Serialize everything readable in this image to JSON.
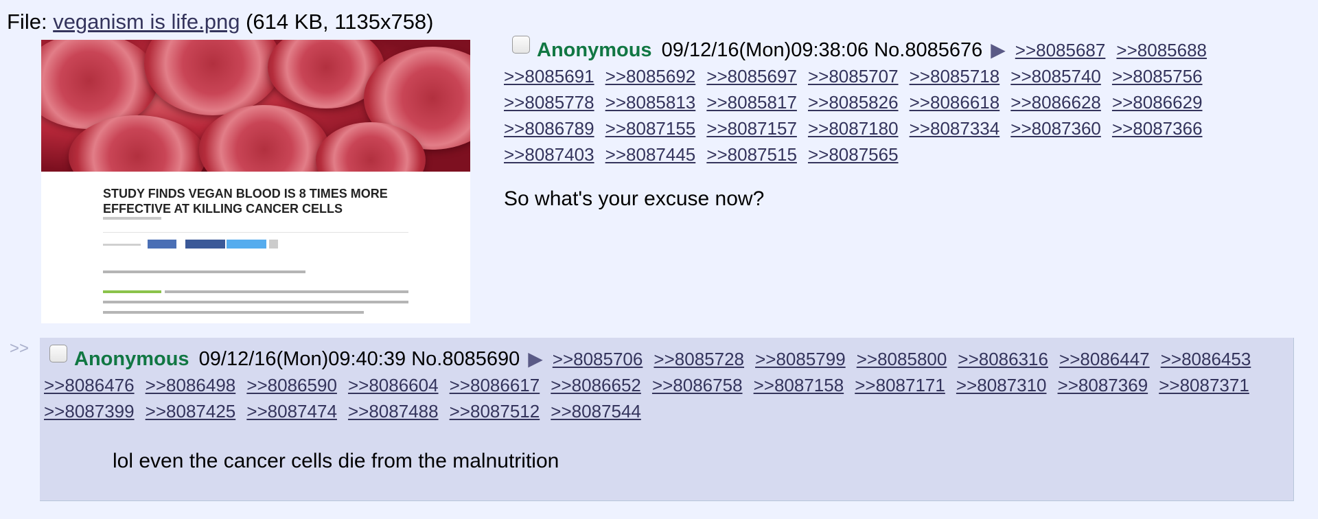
{
  "file": {
    "prefix": "File: ",
    "name": "veganism is life.png",
    "meta": " (614 KB, 1135x758)"
  },
  "thumbnail": {
    "headline": "STUDY FINDS VEGAN BLOOD IS 8 TIMES MORE EFFECTIVE AT KILLING CANCER CELLS"
  },
  "op": {
    "name": "Anonymous",
    "datetime": "09/12/16(Mon)09:38:06",
    "post_no": "No.8085676",
    "arrow": "▶",
    "backlinks": [
      ">>8085687",
      ">>8085688",
      ">>8085691",
      ">>8085692",
      ">>8085697",
      ">>8085707",
      ">>8085718",
      ">>8085740",
      ">>8085756",
      ">>8085778",
      ">>8085813",
      ">>8085817",
      ">>8085826",
      ">>8086618",
      ">>8086628",
      ">>8086629",
      ">>8086789",
      ">>8087155",
      ">>8087157",
      ">>8087180",
      ">>8087334",
      ">>8087360",
      ">>8087366",
      ">>8087403",
      ">>8087445",
      ">>8087515",
      ">>8087565"
    ],
    "comment": "So what's your excuse now?"
  },
  "reply": {
    "side_marker": ">>",
    "name": "Anonymous",
    "datetime": "09/12/16(Mon)09:40:39",
    "post_no": "No.8085690",
    "arrow": "▶",
    "backlinks": [
      ">>8085706",
      ">>8085728",
      ">>8085799",
      ">>8085800",
      ">>8086316",
      ">>8086447",
      ">>8086453",
      ">>8086476",
      ">>8086498",
      ">>8086590",
      ">>8086604",
      ">>8086617",
      ">>8086652",
      ">>8086758",
      ">>8087158",
      ">>8087171",
      ">>8087310",
      ">>8087369",
      ">>8087371",
      ">>8087399",
      ">>8087425",
      ">>8087474",
      ">>8087488",
      ">>8087512",
      ">>8087544"
    ],
    "comment": "lol even the cancer cells die from the malnutrition"
  },
  "colors": {
    "page_bg": "#eef2ff",
    "reply_bg": "#d6daf0",
    "name": "#117743",
    "link": "#34345c"
  }
}
